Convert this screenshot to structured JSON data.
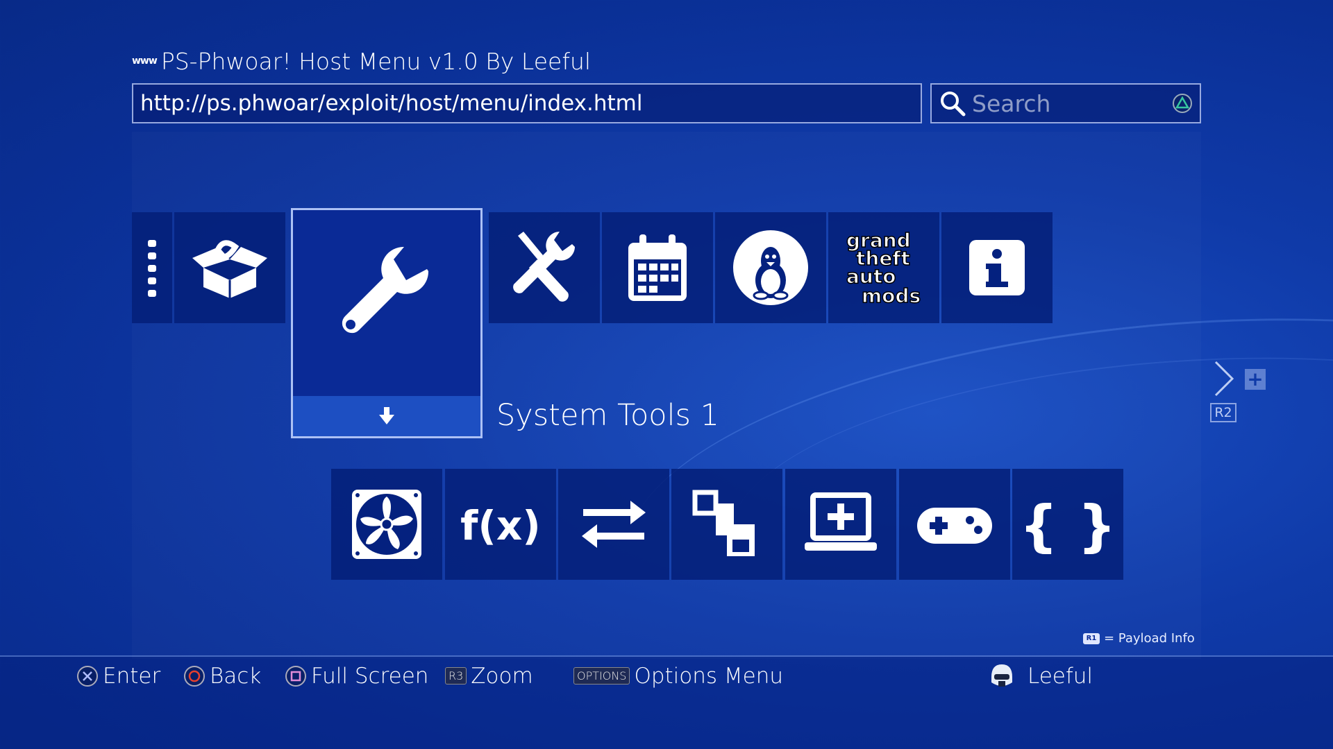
{
  "header": {
    "www_icon": "www",
    "title": "PS-Phwoar! Host Menu v1.0 By Leeful"
  },
  "address_bar": {
    "url": "http://ps.phwoar/exploit/host/menu/index.html"
  },
  "search": {
    "placeholder": "Search",
    "icon": "search-icon",
    "button_icon": "triangle-icon"
  },
  "top_row": {
    "items": [
      {
        "icon": "more-dots-icon"
      },
      {
        "icon": "open-box-icon"
      },
      {
        "icon": "wrench-icon",
        "selected": true
      },
      {
        "icon": "tools-cross-icon"
      },
      {
        "icon": "calendar-icon"
      },
      {
        "icon": "linux-tux-icon"
      },
      {
        "icon": "gta-mods-logo",
        "logo_text": "grand theft auto mods"
      },
      {
        "icon": "info-icon"
      }
    ],
    "selected_label": "System Tools 1",
    "selected_bar_icon": "down-arrow-icon"
  },
  "bottom_row": {
    "items": [
      {
        "icon": "fan-icon"
      },
      {
        "icon": "function-icon",
        "text": "f(x)"
      },
      {
        "icon": "swap-arrows-icon"
      },
      {
        "icon": "squares-icon"
      },
      {
        "icon": "laptop-plus-icon"
      },
      {
        "icon": "gamepad-icon"
      },
      {
        "icon": "braces-icon",
        "text": "{ }"
      }
    ]
  },
  "nav": {
    "r2_label": "R2",
    "next_icon": "chevron-right-icon",
    "plus_icon": "plus-icon"
  },
  "payload_info": {
    "badge": "R1",
    "text": "= Payload Info"
  },
  "footer": {
    "enter": {
      "glyph": "cross-button",
      "label": "Enter"
    },
    "back": {
      "glyph": "circle-button",
      "label": "Back"
    },
    "fullscreen": {
      "glyph": "square-button",
      "label": "Full Screen"
    },
    "zoom": {
      "tag": "R3",
      "label": "Zoom"
    },
    "options": {
      "tag": "OPTIONS",
      "label": "Options Menu"
    },
    "user": {
      "avatar": "trooper-avatar",
      "name": "Leeful"
    }
  },
  "colors": {
    "background": "#0f3aa8",
    "tile": "#04217f",
    "selected_bar": "#1d4fc2",
    "circle_button": "#e8402d",
    "triangle_button": "#37c7a0"
  }
}
